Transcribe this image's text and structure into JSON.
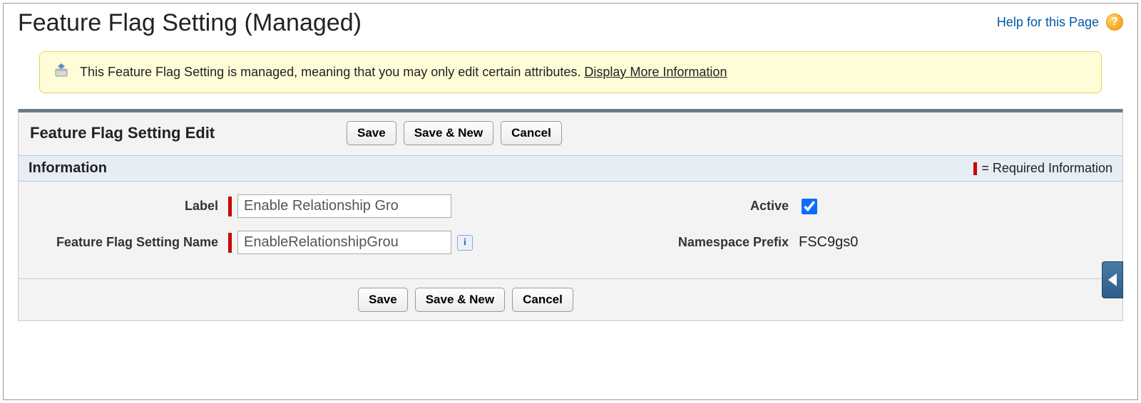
{
  "page": {
    "title": "Feature Flag Setting (Managed)",
    "help_link": "Help for this Page"
  },
  "banner": {
    "text": "This Feature Flag Setting is managed, meaning that you may only edit certain attributes. ",
    "more_link": "Display More Information"
  },
  "panel": {
    "title": "Feature Flag Setting Edit",
    "section_title": "Information",
    "required_legend": "= Required Information"
  },
  "buttons": {
    "save": "Save",
    "save_new": "Save & New",
    "cancel": "Cancel"
  },
  "fields": {
    "label": {
      "label": "Label",
      "value": "Enable Relationship Gro"
    },
    "name": {
      "label": "Feature Flag Setting Name",
      "value": "EnableRelationshipGrou"
    },
    "active": {
      "label": "Active",
      "checked": true
    },
    "namespace": {
      "label": "Namespace Prefix",
      "value": "FSC9gs0"
    }
  }
}
